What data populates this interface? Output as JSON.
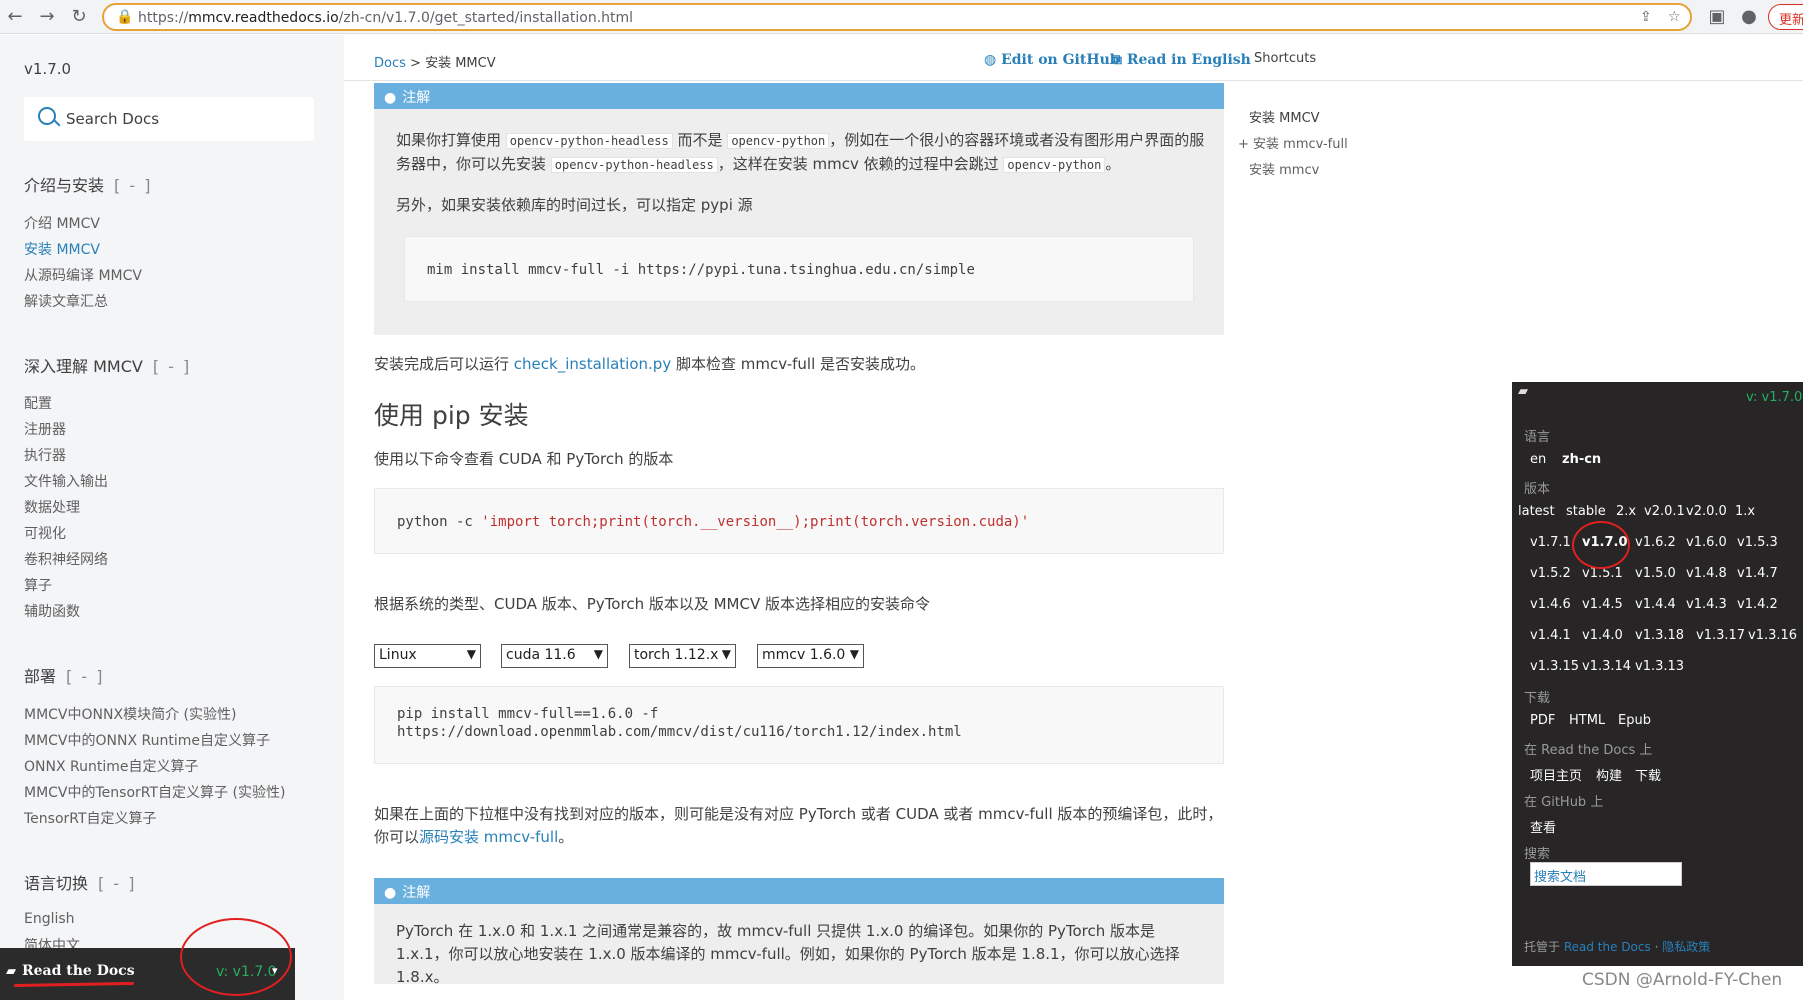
{
  "browser": {
    "url_prefix": "https://",
    "url_host": "mmcv.readthedocs.io",
    "url_path": "/zh-cn/v1.7.0/get_started/installation.html",
    "update_label": "更新"
  },
  "sidebar": {
    "version": "v1.7.0",
    "search_label": "Search Docs",
    "toggle": "[ - ]",
    "sections": [
      {
        "title": "介绍与安装",
        "items": [
          "介绍 MMCV",
          "安装 MMCV",
          "从源码编译 MMCV",
          "解读文章汇总"
        ]
      },
      {
        "title": "深入理解 MMCV",
        "items": [
          "配置",
          "注册器",
          "执行器",
          "文件输入输出",
          "数据处理",
          "可视化",
          "卷积神经网络",
          "算子",
          "辅助函数"
        ]
      },
      {
        "title": "部署",
        "items": [
          "MMCV中ONNX模块简介 (实验性)",
          "MMCV中的ONNX Runtime自定义算子",
          "ONNX Runtime自定义算子",
          "MMCV中的TensorRT自定义算子 (实验性)",
          "TensorRT自定义算子"
        ]
      },
      {
        "title": "语言切换",
        "items": [
          "English",
          "简体中文"
        ]
      }
    ],
    "active_item": "安装 MMCV",
    "badge_name": "Read the Docs",
    "badge_version": "v: v1.7.0"
  },
  "header": {
    "breadcrumb_link": "Docs",
    "breadcrumb_sep": ">",
    "breadcrumb_current": "安装 MMCV",
    "edit_github": "Edit on GitHub",
    "read_english": "Read in English",
    "shortcuts": "Shortcuts"
  },
  "content": {
    "note_label": "注解",
    "note1_p1_a": "如果你打算使用",
    "note1_code1": "opencv-python-headless",
    "note1_p1_b": "而不是",
    "note1_code2": "opencv-python",
    "note1_p1_c": "，例如在一个很小的容器环境或者没有图形用户界面的服务器中，你可以先安装",
    "note1_code3": "opencv-python-headless",
    "note1_p1_d": "，这样在安装 mmcv 依赖的过程中会跳过",
    "note1_code4": "opencv-python",
    "note1_p1_e": "。",
    "note1_p2": "另外，如果安装依赖库的时间过长，可以指定 pypi 源",
    "note1_cmd": "mim install mmcv-full -i https://pypi.tuna.tsinghua.edu.cn/simple",
    "check_a": "安装完成后可以运行",
    "check_link": "check_installation.py",
    "check_b": "脚本检查 mmcv-full 是否安装成功。",
    "pip_heading": "使用 pip 安装",
    "pip_intro": "使用以下命令查看 CUDA 和 PyTorch 的版本",
    "pip_cmd_prefix": "python -c ",
    "pip_cmd_str": "'import torch;print(torch.__version__);print(torch.version.cuda)'",
    "choose_text": "根据系统的类型、CUDA 版本、PyTorch 版本以及 MMCV 版本选择相应的安装命令",
    "selects": {
      "os": "Linux",
      "cuda": "cuda 11.6",
      "torch": "torch 1.12.x",
      "mmcv": "mmcv 1.6.0"
    },
    "install_cmd_1": "pip install mmcv-full==1.6.0 -f",
    "install_cmd_2": "https://download.openmmlab.com/mmcv/dist/cu116/torch1.12/index.html",
    "notfound_a": "如果在上面的下拉框中没有找到对应的版本，则可能是没有对应 PyTorch 或者 CUDA 或者 mmcv-full 版本的预编译包，此时，你可以",
    "notfound_link": "源码安装 mmcv-full",
    "notfound_b": "。",
    "note2_text": "PyTorch 在 1.x.0 和 1.x.1 之间通常是兼容的，故 mmcv-full 只提供 1.x.0 的编译包。如果你的 PyTorch 版本是 1.x.1，你可以放心地安装在 1.x.0 版本编译的 mmcv-full。例如，如果你的 PyTorch 版本是 1.8.1，你可以放心选择 1.8.x。"
  },
  "toc": {
    "items": [
      "安装 MMCV",
      "+ 安装 mmcv-full",
      "安装 mmcv"
    ]
  },
  "flyout": {
    "header_version": "v: v1.7.0",
    "lang_title": "语言",
    "langs": [
      "en",
      "zh-cn"
    ],
    "version_title": "版本",
    "versions": [
      [
        "latest",
        "stable",
        "2.x",
        "v2.0.1",
        "v2.0.0",
        "1.x"
      ],
      [
        "v1.7.1",
        "v1.7.0",
        "v1.6.2",
        "v1.6.0",
        "v1.5.3"
      ],
      [
        "v1.5.2",
        "v1.5.1",
        "v1.5.0",
        "v1.4.8",
        "v1.4.7"
      ],
      [
        "v1.4.6",
        "v1.4.5",
        "v1.4.4",
        "v1.4.3",
        "v1.4.2"
      ],
      [
        "v1.4.1",
        "v1.4.0",
        "v1.3.18",
        "v1.3.17",
        "v1.3.16"
      ],
      [
        "v1.3.15",
        "v1.3.14",
        "v1.3.13"
      ]
    ],
    "current_version": "v1.7.0",
    "download_title": "下载",
    "downloads": [
      "PDF",
      "HTML",
      "Epub"
    ],
    "rtd_title": "在 Read the Docs 上",
    "rtd_items": [
      "项目主页",
      "构建",
      "下载"
    ],
    "github_title": "在 GitHub 上",
    "github_items": [
      "查看"
    ],
    "search_title": "搜索",
    "search_placeholder": "搜索文档",
    "footer_a": "托管于",
    "footer_link1": "Read the Docs",
    "footer_dot": "·",
    "footer_link2": "隐私政策"
  },
  "watermark": "CSDN @Arnold-FY-Chen"
}
